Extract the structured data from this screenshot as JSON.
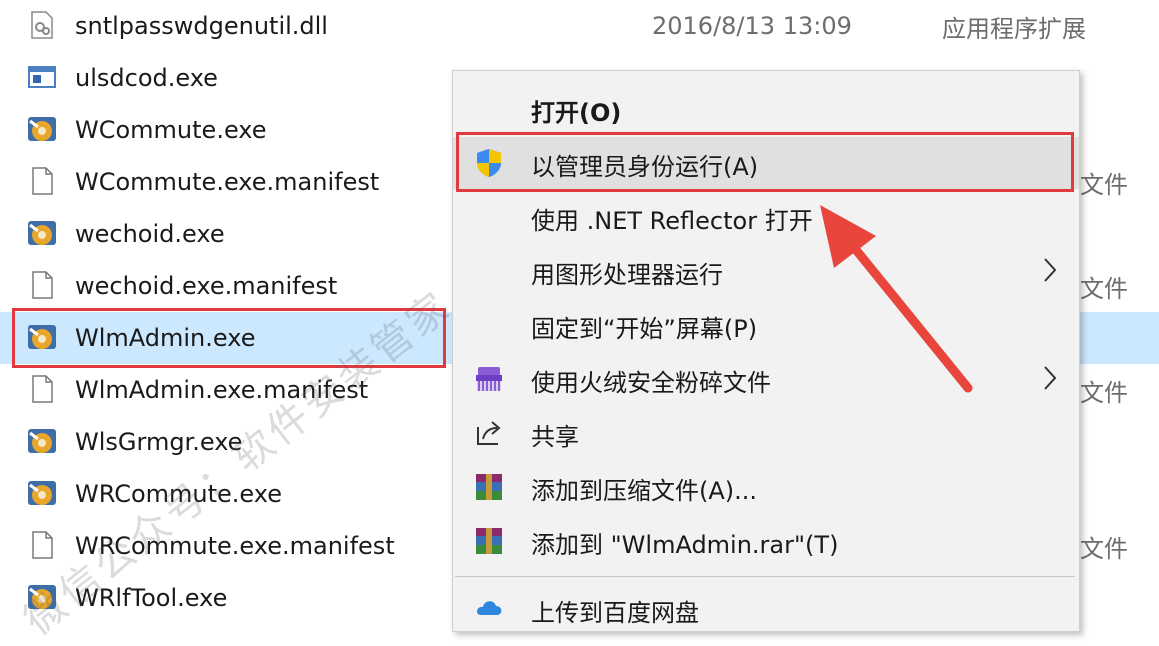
{
  "files": [
    {
      "name": "sntlpasswdgenutil.dll",
      "icon": "dll-file-icon",
      "date": "2016/8/13 13:09",
      "type": "应用程序扩展"
    },
    {
      "name": "ulsdcod.exe",
      "icon": "app-window-icon",
      "date": "",
      "type": ""
    },
    {
      "name": "WCommute.exe",
      "icon": "sentinel-exe-icon",
      "date": "",
      "type": ""
    },
    {
      "name": "WCommute.exe.manifest",
      "icon": "blank-file-icon",
      "date": "",
      "type": "文件"
    },
    {
      "name": "wechoid.exe",
      "icon": "sentinel-exe-icon",
      "date": "",
      "type": ""
    },
    {
      "name": "wechoid.exe.manifest",
      "icon": "blank-file-icon",
      "date": "",
      "type": "文件"
    },
    {
      "name": "WlmAdmin.exe",
      "icon": "sentinel-exe-icon",
      "date": "",
      "type": ""
    },
    {
      "name": "WlmAdmin.exe.manifest",
      "icon": "blank-file-icon",
      "date": "",
      "type": "文件"
    },
    {
      "name": "WlsGrmgr.exe",
      "icon": "sentinel-exe-icon",
      "date": "",
      "type": ""
    },
    {
      "name": "WRCommute.exe",
      "icon": "sentinel-exe-icon",
      "date": "",
      "type": ""
    },
    {
      "name": "WRCommute.exe.manifest",
      "icon": "blank-file-icon",
      "date": "",
      "type": "文件"
    },
    {
      "name": "WRlfTool.exe",
      "icon": "sentinel-exe-icon",
      "date": "",
      "type": ""
    }
  ],
  "context_menu": {
    "items": [
      {
        "label": "打开(O)",
        "icon": "",
        "bold": true,
        "submenu": false
      },
      {
        "label": "以管理员身份运行(A)",
        "icon": "uac-shield-icon",
        "bold": false,
        "submenu": false
      },
      {
        "label": "使用 .NET Reflector 打开",
        "icon": "",
        "bold": false,
        "submenu": false
      },
      {
        "label": "用图形处理器运行",
        "icon": "",
        "bold": false,
        "submenu": true
      },
      {
        "label": "固定到“开始”屏幕(P)",
        "icon": "",
        "bold": false,
        "submenu": false
      },
      {
        "label": "使用火绒安全粉碎文件",
        "icon": "huorong-shredder-icon",
        "bold": false,
        "submenu": true
      },
      {
        "label": "共享",
        "icon": "share-icon",
        "bold": false,
        "submenu": false
      },
      {
        "label": "添加到压缩文件(A)...",
        "icon": "winrar-icon",
        "bold": false,
        "submenu": false
      },
      {
        "label": "添加到 \"WlmAdmin.rar\"(T)",
        "icon": "winrar-icon",
        "bold": false,
        "submenu": false
      },
      {
        "label": "上传到百度网盘",
        "icon": "baidu-netdisk-icon",
        "bold": false,
        "submenu": false
      }
    ]
  },
  "watermark": "微信公众号：软件安装管家",
  "colors": {
    "highlight_border": "#e0393e",
    "selection": "#cce8ff",
    "menu_bg": "#f2f2f2",
    "arrow": "#e8453c"
  }
}
